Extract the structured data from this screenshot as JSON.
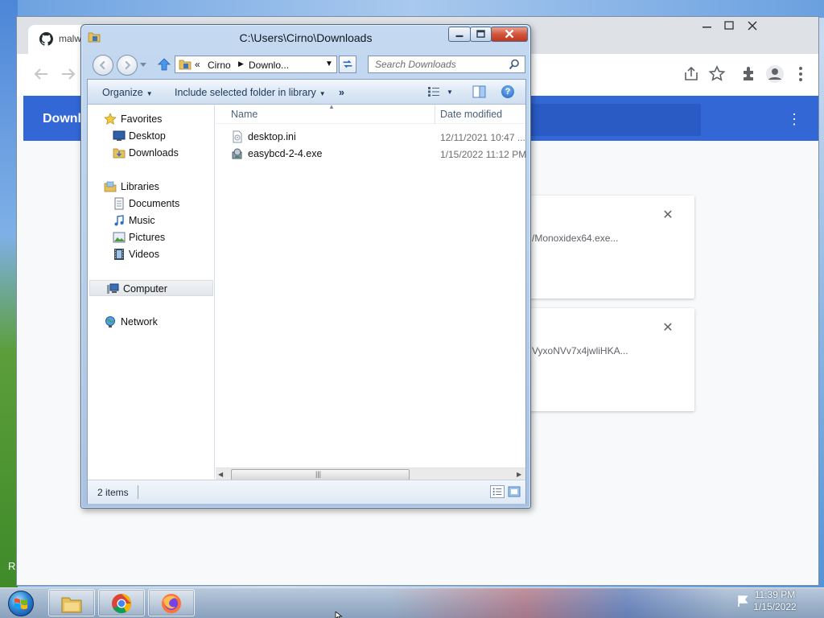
{
  "chrome": {
    "tab_title": "malw",
    "page_header_title": "Downl",
    "download_cards": [
      {
        "filename_fragment": "/Monoxidex64.exe..."
      },
      {
        "filename_fragment": "VyxoNVv7x4jwliHKA..."
      }
    ],
    "menu_glyph": "⋮",
    "close_glyph": "✕"
  },
  "explorer": {
    "title": "C:\\Users\\Cirno\\Downloads",
    "address": {
      "chevron": "«",
      "segments": [
        "Cirno",
        "Downlo..."
      ]
    },
    "search": {
      "placeholder": "Search Downloads"
    },
    "commands": {
      "organize": "Organize",
      "include": "Include selected folder in library",
      "more": "»"
    },
    "help_glyph": "?",
    "tree": {
      "favorites": "Favorites",
      "desktop": "Desktop",
      "downloads": "Downloads",
      "libraries": "Libraries",
      "documents": "Documents",
      "music": "Music",
      "pictures": "Pictures",
      "videos": "Videos",
      "computer": "Computer",
      "network": "Network"
    },
    "columns": {
      "name": "Name",
      "date_modified": "Date modified"
    },
    "files": [
      {
        "name": "desktop.ini",
        "date": "12/11/2021 10:47 ...",
        "icon": "ini-file-icon"
      },
      {
        "name": "easybcd-2-4.exe",
        "date": "1/15/2022 11:12 PM",
        "icon": "installer-exe-icon"
      }
    ],
    "status": {
      "count": "2 items"
    }
  },
  "taskbar": {
    "time": "11:39 PM",
    "date": "1/15/2022"
  },
  "desktop": {
    "edge_letter": "R"
  },
  "colors": {
    "chrome_accent": "#3367d6",
    "close_red": "#c0361c"
  }
}
